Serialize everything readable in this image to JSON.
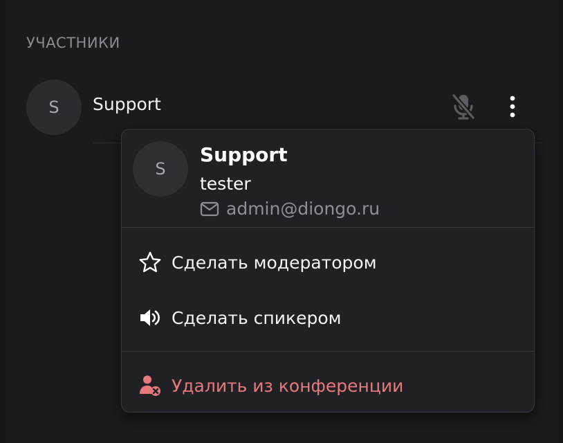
{
  "section": {
    "title": "УЧАСТНИКИ"
  },
  "participant": {
    "avatar_initial": "S",
    "name": "Support"
  },
  "icons": {
    "mic": "microphone-muted-icon",
    "more": "more-vertical-icon",
    "mail": "mail-icon",
    "star": "star-icon",
    "speaker": "speaker-icon",
    "remove_user": "user-remove-icon"
  },
  "menu": {
    "avatar_initial": "S",
    "name": "Support",
    "role": "tester",
    "email": "admin@diongo.ru",
    "items": [
      {
        "label": "Сделать модератором"
      },
      {
        "label": "Сделать спикером"
      },
      {
        "label": "Удалить из конференции"
      }
    ]
  },
  "colors": {
    "background": "#1b1b1d",
    "menu_background": "#202124",
    "muted_text": "#8a8b93",
    "danger": "#e8787c"
  }
}
